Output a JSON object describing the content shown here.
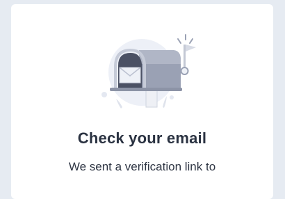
{
  "card": {
    "title": "Check your email",
    "message": "We sent a verification link to"
  },
  "illustration": {
    "icon": "mailbox-icon"
  },
  "colors": {
    "page_background": "#e6ebf2",
    "card_background": "#ffffff",
    "title_text": "#2a3241",
    "body_text": "#2f3644",
    "illustration_circle": "#edf0f7",
    "mailbox_body": "#99a0b3",
    "mailbox_dark": "#4b5164"
  }
}
